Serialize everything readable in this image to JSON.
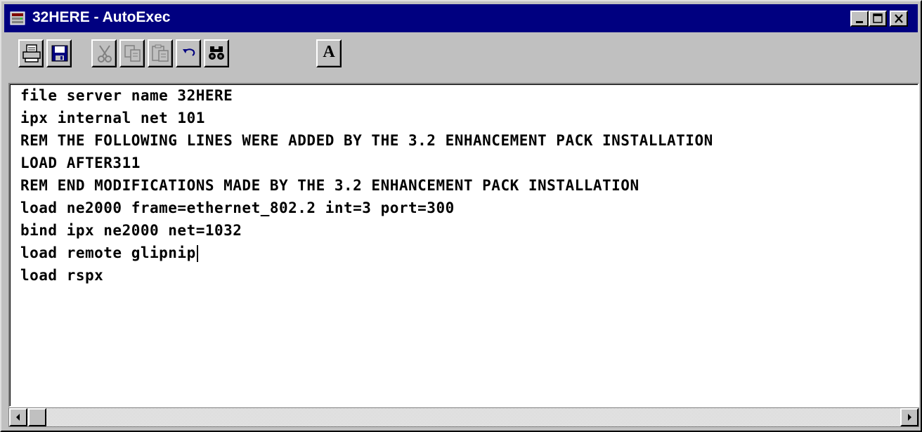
{
  "window": {
    "title": "32HERE - AutoExec",
    "app_icon": "netware-server-icon",
    "colors": {
      "titlebar": "#000080",
      "chrome": "#c0c0c0",
      "editor_bg": "#ffffff"
    }
  },
  "title_controls": [
    {
      "name": "minimize-button",
      "icon": "minimize-icon"
    },
    {
      "name": "maximize-button",
      "icon": "maximize-icon"
    },
    {
      "name": "close-button",
      "icon": "close-icon"
    }
  ],
  "toolbar": {
    "buttons": [
      {
        "name": "print-button",
        "icon": "printer-icon",
        "enabled": true
      },
      {
        "name": "save-button",
        "icon": "floppy-disk-icon",
        "enabled": true
      },
      {
        "name": "cut-button",
        "icon": "scissors-icon",
        "enabled": false
      },
      {
        "name": "copy-button",
        "icon": "copy-icon",
        "enabled": false
      },
      {
        "name": "paste-button",
        "icon": "paste-icon",
        "enabled": false
      },
      {
        "name": "undo-button",
        "icon": "undo-arrow-icon",
        "enabled": true
      },
      {
        "name": "find-button",
        "icon": "binoculars-icon",
        "enabled": true
      },
      {
        "name": "font-button",
        "icon": "font-icon",
        "label": "A",
        "enabled": true
      }
    ]
  },
  "editor": {
    "lines": [
      "file server name 32HERE",
      "ipx internal net 101",
      "REM THE FOLLOWING LINES WERE ADDED BY THE 3.2 ENHANCEMENT PACK INSTALLATION",
      "LOAD AFTER311",
      "REM END MODIFICATIONS MADE BY THE 3.2 ENHANCEMENT PACK INSTALLATION",
      "load ne2000 frame=ethernet_802.2 int=3 port=300",
      "bind ipx ne2000 net=1032",
      "load remote glipnip",
      "load rspx"
    ],
    "caret_line_index": 7
  },
  "scrollbar": {
    "orientation": "horizontal",
    "position": 0
  }
}
